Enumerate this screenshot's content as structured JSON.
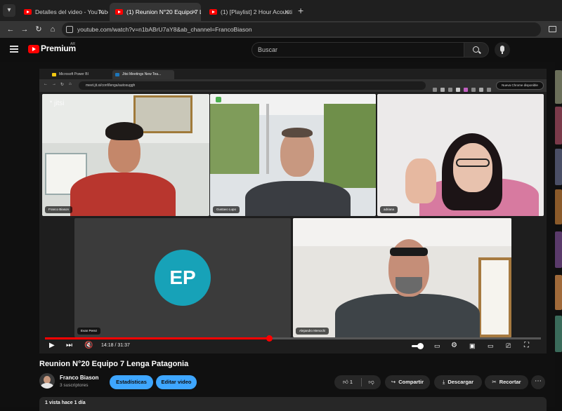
{
  "browser": {
    "tabs": [
      {
        "title": "Detalles del video - YouTube St"
      },
      {
        "title": "(1) Reunion N°20 Equipo 7 Leng"
      },
      {
        "title": "(1) [Playlist] 2 Hour Acousti"
      }
    ],
    "url": "youtube.com/watch?v=n1bABrU7aY8&ab_channel=FrancoBiason"
  },
  "youtube": {
    "logo_text": "Premium",
    "logo_region": "AR",
    "search_placeholder": "Buscar"
  },
  "video": {
    "inner_tabs": [
      {
        "title": "Microsoft Power BI"
      },
      {
        "title": "Jitsi Meetings New Tea..."
      }
    ],
    "inner_url": "meet.jit.si/conf/lenga/autosuggh",
    "inner_profile": "Nueva Chrome disponible",
    "watermark": "jitsi",
    "participants": [
      {
        "name": "Franco Biason"
      },
      {
        "name": "Gustavo Lupo"
      },
      {
        "name": "adriana"
      },
      {
        "name": "Evan Perez"
      },
      {
        "name": "Alejandro Menochi"
      }
    ],
    "avatar_initials": "EP",
    "current_time": "14:18",
    "duration": "31:37",
    "time_separator": " / ",
    "progress_fraction": 0.452
  },
  "details": {
    "title": "Reunion N°20 Equipo 7 Lenga Patagonia",
    "channel": "Franco Biason",
    "subscribers": "3 suscriptores",
    "btn_stats": "Estadísticas",
    "btn_edit": "Editar video",
    "likes": "1",
    "btn_share": "Compartir",
    "btn_download": "Descargar",
    "btn_clip": "Recortar",
    "meta": "1 vista  hace 1 día"
  },
  "colors": {
    "youtube_red": "#ff0000",
    "accent_blue": "#3ea6ff",
    "avatar_teal": "#17a2b8"
  }
}
